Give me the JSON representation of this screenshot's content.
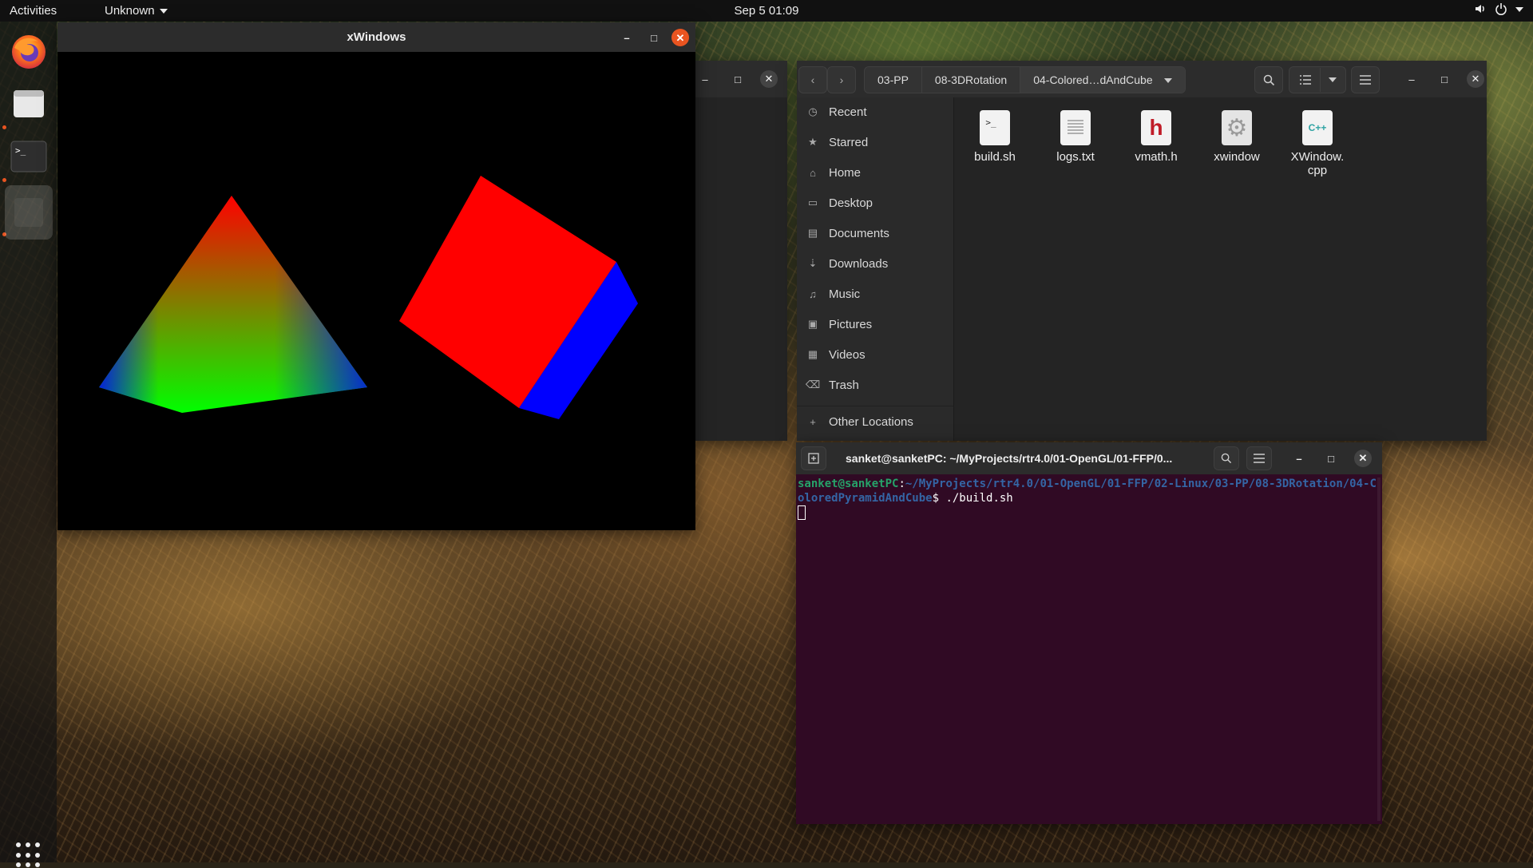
{
  "topbar": {
    "activities": "Activities",
    "app_menu": "Unknown",
    "clock": "Sep 5  01:09",
    "icons": [
      "volume-icon",
      "power-icon",
      "system-menu-caret-icon"
    ]
  },
  "dock": {
    "items": [
      "firefox",
      "files",
      "terminal",
      "xwindow-app"
    ],
    "show_apps_icon": "grid-icon"
  },
  "xwindow": {
    "title": "xWindows",
    "scene": {
      "pyramid_colors": [
        "#ff0000",
        "#00ff00",
        "#0000ff"
      ],
      "cube_front_color": "#ff0000",
      "cube_side_color": "#0000ff"
    }
  },
  "files": {
    "breadcrumbs": [
      "03-PP",
      "08-3DRotation",
      "04-Colored…dAndCube"
    ],
    "sidebar": [
      {
        "label": "Recent",
        "icon": "clock-icon"
      },
      {
        "label": "Starred",
        "icon": "star-icon"
      },
      {
        "label": "Home",
        "icon": "home-icon"
      },
      {
        "label": "Desktop",
        "icon": "desktop-icon"
      },
      {
        "label": "Documents",
        "icon": "document-icon"
      },
      {
        "label": "Downloads",
        "icon": "download-icon"
      },
      {
        "label": "Music",
        "icon": "music-icon"
      },
      {
        "label": "Pictures",
        "icon": "picture-icon"
      },
      {
        "label": "Videos",
        "icon": "video-icon"
      },
      {
        "label": "Trash",
        "icon": "trash-icon"
      },
      {
        "label": "Other Locations",
        "icon": "plus-icon"
      }
    ],
    "items": [
      {
        "name": "build.sh",
        "glyph": ">_",
        "icon": "script-icon"
      },
      {
        "name": "logs.txt",
        "glyph": "",
        "icon": "text-file-icon"
      },
      {
        "name": "vmath.h",
        "glyph": "h",
        "icon": "header-file-icon"
      },
      {
        "name": "xwindow",
        "glyph": "⚙",
        "icon": "executable-icon"
      },
      {
        "name": "XWindow.\ncpp",
        "glyph": "C++",
        "icon": "cpp-file-icon"
      }
    ]
  },
  "terminal": {
    "title": "sanket@sanketPC: ~/MyProjects/rtr4.0/01-OpenGL/01-FFP/0...",
    "prompt_user": "sanket@sanketPC",
    "prompt_path": "~/MyProjects/rtr4.0/01-OpenGL/01-FFP/02-Linux/03-PP/08-3DRotation/04-ColoredPyramidAndCube",
    "prompt_symbol": "$",
    "command": " ./build.sh"
  },
  "colors": {
    "accent": "#e95420",
    "terminal_bg": "#300a24",
    "topbar_bg": "#111111"
  }
}
